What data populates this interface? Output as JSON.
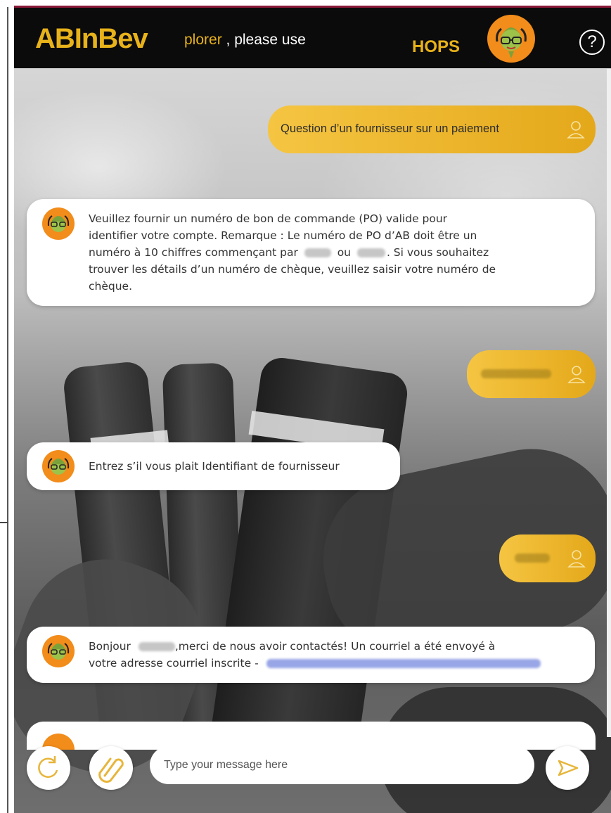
{
  "header": {
    "logo_text": "ABInBev",
    "marquee_dim": "plorer",
    "marquee_text": ", please use",
    "bot_name": "HOPS",
    "help_label": "?"
  },
  "messages": [
    {
      "from": "user",
      "text": "Question d’un fournisseur sur un paiement"
    },
    {
      "from": "bot",
      "lines": [
        "Veuillez fournir un numéro de bon de commande (PO) valide pour",
        "identifier votre compte. Remarque : Le numéro de PO d’AB doit être un",
        "numéro à 10 chiffres commençant par",
        "ou",
        ". Si vous souhaitez",
        "trouver les détails d’un numéro de chèque, veuillez saisir votre numéro de",
        "chèque."
      ]
    },
    {
      "from": "user",
      "text": ""
    },
    {
      "from": "bot",
      "text": "Entrez s’il vous plait Identifiant de fournisseur"
    },
    {
      "from": "user",
      "text": ""
    },
    {
      "from": "bot",
      "lines": [
        "Bonjour",
        ",merci de nous avoir contactés! Un courriel a été envoyé à",
        "votre adresse courriel inscrite -"
      ]
    }
  ],
  "composer": {
    "placeholder": "Type your message here"
  },
  "icons": {
    "refresh": "refresh-icon",
    "attach": "paperclip-icon",
    "send": "send-icon",
    "user": "user-icon",
    "bot": "hops-mascot-icon"
  },
  "colors": {
    "header_bg": "#0b0b0b",
    "brand_gold": "#e8b21a",
    "user_bubble": "#f5c542",
    "bot_bubble": "#ffffff"
  }
}
